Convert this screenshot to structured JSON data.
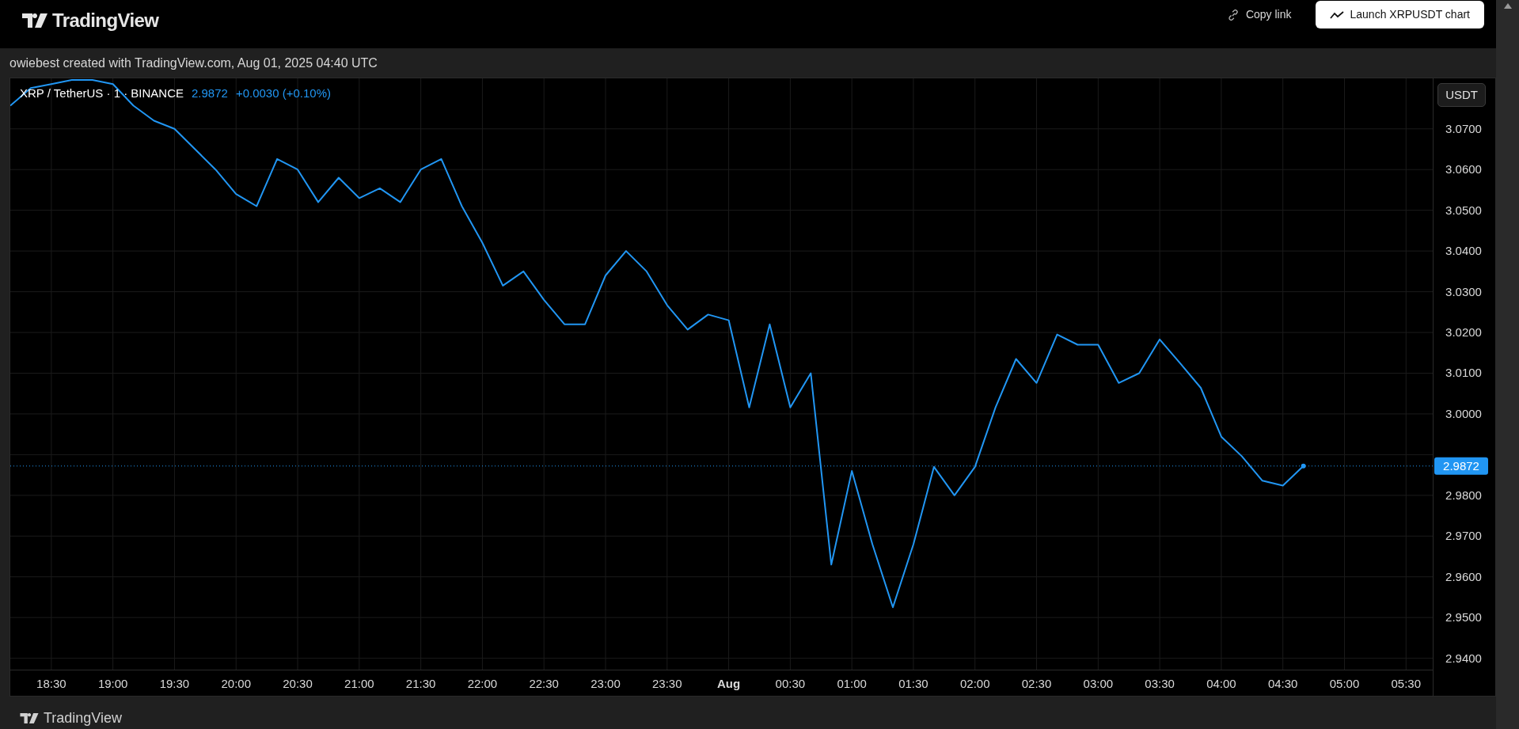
{
  "header": {
    "logo_text": "TradingView",
    "copy_link": "Copy link",
    "launch_button": "Launch XRPUSDT chart"
  },
  "caption": "owiebest created with TradingView.com, Aug 01, 2025 04:40 UTC",
  "chart": {
    "legend": {
      "symbol": "XRP / TetherUS · 1 · BINANCE",
      "price": "2.9872",
      "change": "+0.0030 (+0.10%)"
    },
    "currency_button": "USDT",
    "chart_data": {
      "type": "line",
      "grid": true,
      "x": [
        1090,
        1100,
        1110,
        1120,
        1130,
        1140,
        1150,
        1160,
        1170,
        1180,
        1190,
        1200,
        1210,
        1220,
        1230,
        1240,
        1250,
        1260,
        1270,
        1280,
        1290,
        1300,
        1310,
        1320,
        1330,
        1340,
        1350,
        1360,
        1370,
        1380,
        1390,
        1400,
        1410,
        1420,
        1430,
        1440,
        1450,
        1460,
        1470,
        1480,
        1490,
        1500,
        1510,
        1520,
        1530,
        1540,
        1550,
        1560,
        1570,
        1580,
        1590,
        1600,
        1610,
        1620,
        1630,
        1640,
        1650,
        1660,
        1670,
        1680,
        1690,
        1700,
        1710,
        1720
      ],
      "series": [
        {
          "color": "#2196f3",
          "values": [
            3.0757,
            3.08,
            3.081,
            3.082,
            3.082,
            3.081,
            3.0757,
            3.072,
            3.07,
            3.065,
            3.06,
            3.054,
            3.051,
            3.0626,
            3.06,
            3.052,
            3.058,
            3.053,
            3.0554,
            3.052,
            3.06,
            3.0626,
            3.051,
            3.042,
            3.0315,
            3.035,
            3.028,
            3.022,
            3.022,
            3.034,
            3.04,
            3.035,
            3.0267,
            3.0207,
            3.0244,
            3.023,
            3.0016,
            3.022,
            3.0016,
            3.01,
            2.963,
            2.986,
            2.968,
            2.9525,
            2.968,
            2.987,
            2.98,
            2.987,
            3.0016,
            3.0135,
            3.0076,
            3.0195,
            3.017,
            3.017,
            3.0076,
            3.01,
            3.0183,
            3.0124,
            3.0064,
            2.9944,
            2.9896,
            2.9836,
            2.9824,
            2.9872
          ]
        }
      ],
      "ref_lines": [
        {
          "axis": "y",
          "value": 2.9872,
          "color": "#2196f3",
          "label": "2.9872"
        }
      ],
      "xlim": [
        1090,
        1783
      ],
      "xticks": [
        {
          "value": 1110,
          "label": "18:30"
        },
        {
          "value": 1140,
          "label": "19:00"
        },
        {
          "value": 1170,
          "label": "19:30"
        },
        {
          "value": 1200,
          "label": "20:00"
        },
        {
          "value": 1230,
          "label": "20:30"
        },
        {
          "value": 1260,
          "label": "21:00"
        },
        {
          "value": 1290,
          "label": "21:30"
        },
        {
          "value": 1320,
          "label": "22:00"
        },
        {
          "value": 1350,
          "label": "22:30"
        },
        {
          "value": 1380,
          "label": "23:00"
        },
        {
          "value": 1410,
          "label": "23:30"
        },
        {
          "value": 1440,
          "label": "Aug"
        }
      ],
      "ylim": [
        2.9372,
        3.0824
      ],
      "yticks": [
        {
          "value": 3.07,
          "label": "3.0700"
        },
        {
          "value": 3.06,
          "label": "3.0600"
        },
        {
          "value": 3.05,
          "label": "3.0500"
        },
        {
          "value": 3.04,
          "label": "3.0400"
        },
        {
          "value": 3.03,
          "label": "3.0300"
        },
        {
          "value": 3.02,
          "label": "3.0200"
        },
        {
          "value": 3.01,
          "label": "3.0100"
        },
        {
          "value": 3.0,
          "label": "3.0000"
        },
        {
          "value": 2.98,
          "label": "2.9800"
        },
        {
          "value": 2.97,
          "label": "2.9700"
        },
        {
          "value": 2.96,
          "label": "2.9600"
        },
        {
          "value": 2.95,
          "label": "2.9500"
        },
        {
          "value": 2.94,
          "label": "2.9400"
        }
      ]
    }
  },
  "time_axis_next_day": [
    "00:30",
    "01:00",
    "01:30",
    "02:00",
    "02:30",
    "03:00",
    "03:30",
    "04:00",
    "04:30",
    "05:00",
    "05:30"
  ],
  "footer": {
    "logo_text": "TradingView"
  }
}
